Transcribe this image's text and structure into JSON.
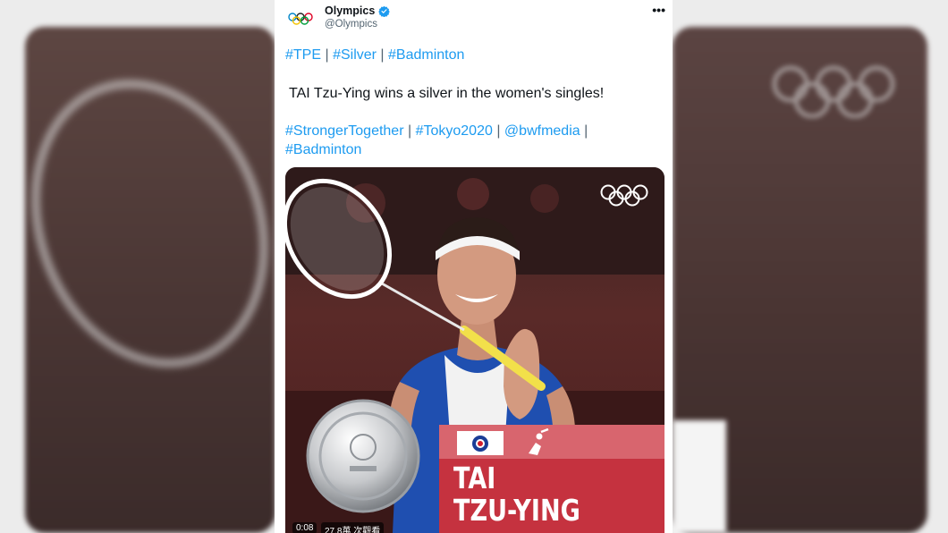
{
  "account": {
    "display_name": "Olympics",
    "handle": "@Olympics",
    "verified": true
  },
  "tweet": {
    "line1": [
      {
        "text": "#TPE",
        "type": "link"
      },
      {
        "text": " | ",
        "type": "sep"
      },
      {
        "text": "#Silver",
        "type": "link"
      },
      {
        "text": " | ",
        "type": "sep"
      },
      {
        "text": "#Badminton",
        "type": "link"
      }
    ],
    "line2": "TAI Tzu-Ying wins a silver in the women's singles!",
    "line3": [
      {
        "text": "#StrongerTogether",
        "type": "link"
      },
      {
        "text": " | ",
        "type": "sep"
      },
      {
        "text": "#Tokyo2020",
        "type": "link"
      },
      {
        "text": " | ",
        "type": "sep"
      },
      {
        "text": "@bwfmedia",
        "type": "link"
      },
      {
        "text": " | ",
        "type": "sep"
      },
      {
        "text": "#Badminton",
        "type": "link"
      }
    ]
  },
  "media": {
    "athlete_first": "TAI",
    "athlete_last": "TZU-YING",
    "video_time": "0:08",
    "video_views": "27.8萬 次觀看"
  },
  "icons": {
    "avatar": "olympic-rings-icon",
    "verified": "verified-badge-icon",
    "more": "more-options-icon",
    "media_logo": "olympic-rings-icon",
    "flag": "chinese-taipei-flag-icon",
    "sport": "badminton-pictogram-icon",
    "medal": "silver-medal-icon"
  },
  "colors": {
    "link": "#1d9bf0",
    "text": "#0f1419",
    "secondary": "#536471",
    "verified": "#1d9bf0",
    "nameplate_top": "#d8656e",
    "nameplate_bottom": "#c5323f"
  }
}
